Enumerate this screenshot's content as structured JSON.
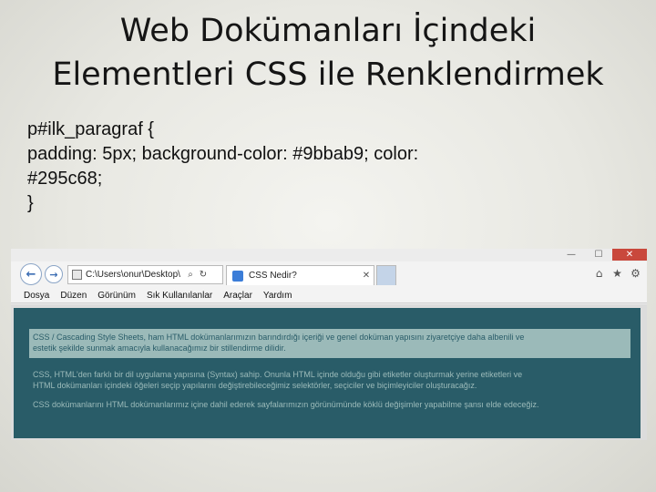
{
  "slide": {
    "title_line1": "Web Dokümanları İçindeki",
    "title_line2": "Elementleri CSS ile Renklendirmek",
    "code": [
      "p#ilk_paragraf {",
      "padding: 5px; background-color: #9bbab9; color:",
      "#295c68;",
      "}"
    ]
  },
  "browser": {
    "window_controls": {
      "minimize": "—",
      "maximize": "☐",
      "close": "✕"
    },
    "toolbar": {
      "back": "←",
      "forward": "→",
      "address": "C:\\Users\\onur\\Desktop\\",
      "search_symbol": "⌕",
      "refresh_symbol": "↻",
      "tab_label": "CSS Nedir?",
      "tab_close": "✕",
      "home": "⌂",
      "favorites": "★",
      "settings": "⚙"
    },
    "menu": [
      "Dosya",
      "Düzen",
      "Görünüm",
      "Sık Kullanılanlar",
      "Araçlar",
      "Yardım"
    ],
    "content": {
      "paragraph1": [
        "CSS / Cascading Style Sheets, ham HTML dokümanlarımızın barındırdığı içeriği ve genel doküman yapısını ziyaretçiye daha albenili ve",
        "estetik şekilde sunmak amacıyla kullanacağımız bir stillendirme dilidir."
      ],
      "paragraph2": [
        "CSS, HTML'den farklı bir dil uygulama yapısına (Syntax) sahip. Onunla HTML içinde olduğu gibi etiketler oluşturmak yerine etiketleri ve",
        "HTML dokümanları içindeki öğeleri seçip yapılarını değiştirebileceğimiz selektörler, seçiciler ve biçimleyiciler oluşturacağız."
      ],
      "paragraph3": [
        "CSS dokümanlarını HTML dokümanlarımız içine dahil ederek sayfalarımızın görünümünde köklü değişimler yapabilme şansı elde edeceğiz."
      ]
    }
  },
  "colors": {
    "para_background": "#9bbab9",
    "para_text": "#295c68",
    "page_background": "#295c68"
  }
}
